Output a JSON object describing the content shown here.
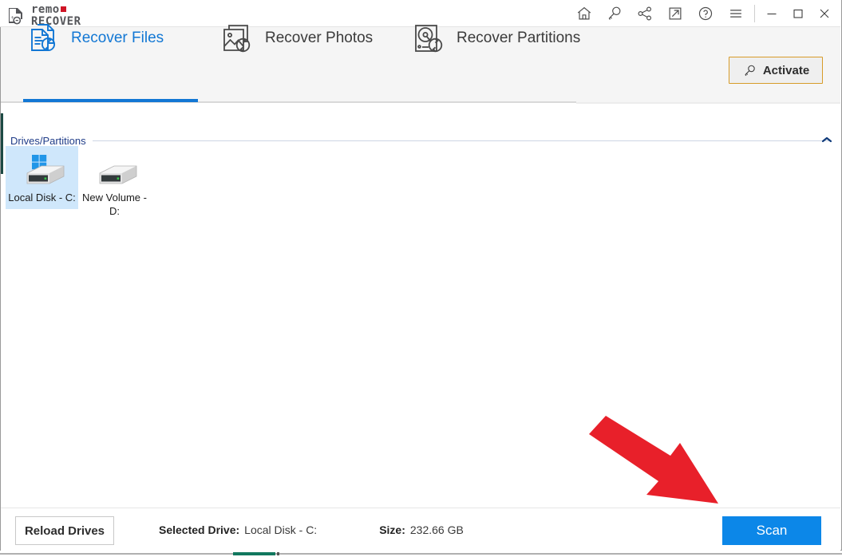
{
  "app": {
    "brand_line1": "remo",
    "brand_line2": "RECOVER",
    "logo_icon": "document-recover-logo-icon",
    "accent_blue": "#1277d4",
    "accent_orange": "#d79b29",
    "accent_red": "#e8202a",
    "scan_blue": "#0c87e8"
  },
  "titlebar": {
    "icons": [
      {
        "name": "home-icon",
        "title": "Home"
      },
      {
        "name": "key-icon",
        "title": "Activate / License"
      },
      {
        "name": "share-icon",
        "title": "Share"
      },
      {
        "name": "upgrade-arrow-icon",
        "title": "Upgrade"
      },
      {
        "name": "help-icon",
        "title": "Help"
      },
      {
        "name": "hamburger-menu-icon",
        "title": "Menu"
      }
    ],
    "window_controls": [
      {
        "name": "minimize-button",
        "glyph": "minimize"
      },
      {
        "name": "maximize-button",
        "glyph": "maximize"
      },
      {
        "name": "close-button",
        "glyph": "close"
      }
    ]
  },
  "tabs": [
    {
      "id": "files",
      "label": "Recover Files",
      "icon": "recover-files-icon",
      "active": true
    },
    {
      "id": "photos",
      "label": "Recover Photos",
      "icon": "recover-photos-icon",
      "active": false
    },
    {
      "id": "partitions",
      "label": "Recover Partitions",
      "icon": "recover-partitions-icon",
      "active": false
    }
  ],
  "activate": {
    "label": "Activate",
    "icon": "key-icon"
  },
  "main": {
    "group_title": "Drives/Partitions",
    "collapse_icon": "chevron-up-icon",
    "drives": [
      {
        "name": "Local Disk - C:",
        "selected": true,
        "badge": "windows-logo-icon"
      },
      {
        "name": "New Volume - D:",
        "selected": false,
        "badge": ""
      }
    ]
  },
  "annotation": {
    "arrow": "red-arrow-pointing-to-scan-button"
  },
  "footer": {
    "reload_label": "Reload Drives",
    "selected_drive_key": "Selected Drive:",
    "selected_drive_value": "Local Disk - C:",
    "size_key": "Size:",
    "size_value": "232.66 GB",
    "scan_label": "Scan"
  }
}
